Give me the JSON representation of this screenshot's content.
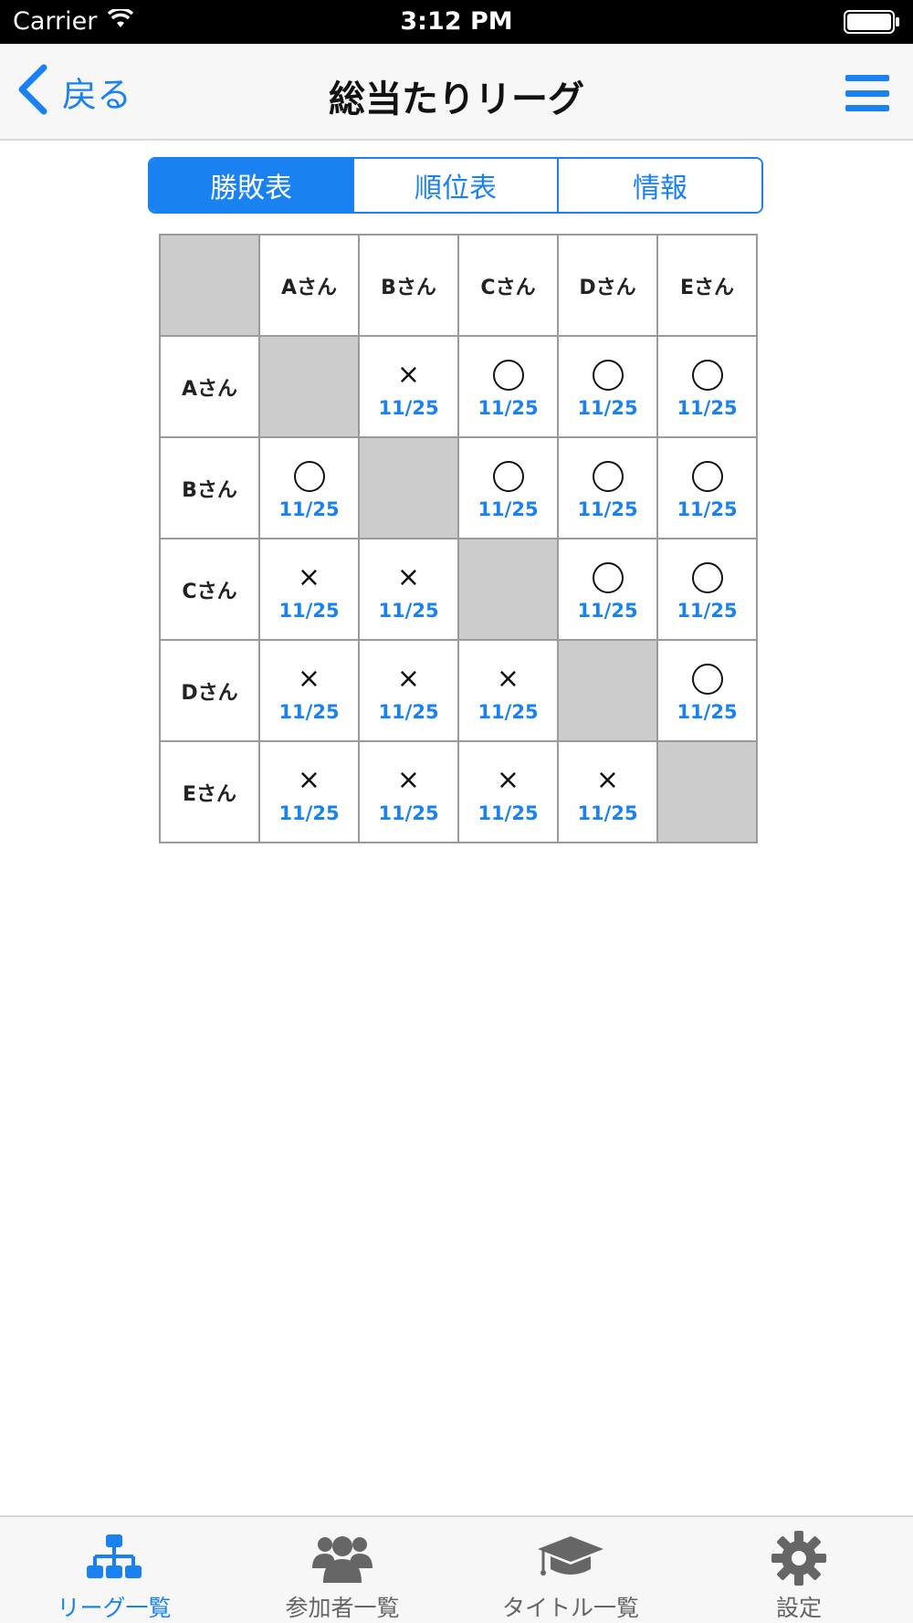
{
  "status_bar": {
    "carrier": "Carrier",
    "time": "3:12 PM"
  },
  "nav": {
    "back_label": "戻る",
    "title": "総当たりリーグ"
  },
  "segments": [
    {
      "label": "勝敗表",
      "active": true
    },
    {
      "label": "順位表",
      "active": false
    },
    {
      "label": "情報",
      "active": false
    }
  ],
  "players": [
    "Aさん",
    "Bさん",
    "Cさん",
    "Dさん",
    "Eさん"
  ],
  "results": [
    [
      null,
      "×",
      "○",
      "○",
      "○"
    ],
    [
      "○",
      null,
      "○",
      "○",
      "○"
    ],
    [
      "×",
      "×",
      null,
      "○",
      "○"
    ],
    [
      "×",
      "×",
      "×",
      null,
      "○"
    ],
    [
      "×",
      "×",
      "×",
      "×",
      null
    ]
  ],
  "dates": [
    [
      null,
      "11/25",
      "11/25",
      "11/25",
      "11/25"
    ],
    [
      "11/25",
      null,
      "11/25",
      "11/25",
      "11/25"
    ],
    [
      "11/25",
      "11/25",
      null,
      "11/25",
      "11/25"
    ],
    [
      "11/25",
      "11/25",
      "11/25",
      null,
      "11/25"
    ],
    [
      "11/25",
      "11/25",
      "11/25",
      "11/25",
      null
    ]
  ],
  "tabs": [
    {
      "label": "リーグ一覧",
      "icon": "sitemap-icon",
      "active": true
    },
    {
      "label": "参加者一覧",
      "icon": "users-icon",
      "active": false
    },
    {
      "label": "タイトル一覧",
      "icon": "graduation-cap-icon",
      "active": false
    },
    {
      "label": "設定",
      "icon": "gear-icon",
      "active": false
    }
  ],
  "colors": {
    "accent": "#1a82f0",
    "diagonal": "#cccccc",
    "grid_border": "#9a9a9a"
  }
}
